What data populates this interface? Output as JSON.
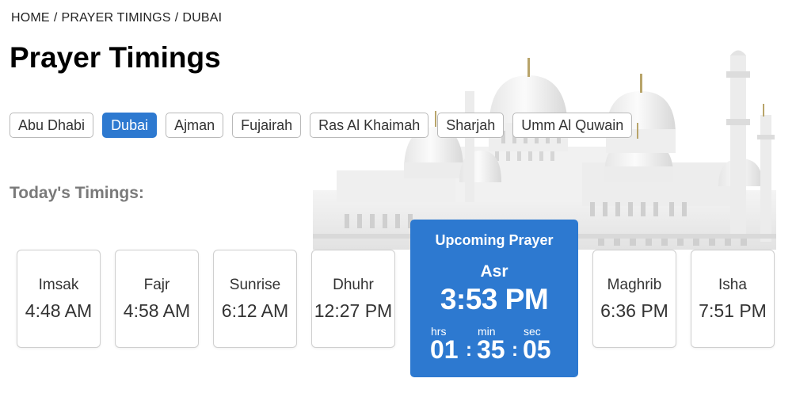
{
  "breadcrumb": {
    "home": "HOME",
    "section": "PRAYER TIMINGS",
    "current": "DUBAI",
    "separator": "/"
  },
  "page": {
    "title": "Prayer Timings",
    "section_title": "Today's Timings:"
  },
  "emirates": [
    {
      "label": "Abu Dhabi",
      "active": false
    },
    {
      "label": "Dubai",
      "active": true
    },
    {
      "label": "Ajman",
      "active": false
    },
    {
      "label": "Fujairah",
      "active": false
    },
    {
      "label": "Ras Al Khaimah",
      "active": false
    },
    {
      "label": "Sharjah",
      "active": false
    },
    {
      "label": "Umm Al Quwain",
      "active": false
    }
  ],
  "timings": [
    {
      "name": "Imsak",
      "time": "4:48 AM"
    },
    {
      "name": "Fajr",
      "time": "4:58 AM"
    },
    {
      "name": "Sunrise",
      "time": "6:12 AM"
    },
    {
      "name": "Dhuhr",
      "time": "12:27 PM"
    },
    {
      "name": "Maghrib",
      "time": "6:36 PM"
    },
    {
      "name": "Isha",
      "time": "7:51 PM"
    }
  ],
  "upcoming": {
    "label": "Upcoming Prayer",
    "name": "Asr",
    "time": "3:53 PM",
    "countdown": {
      "hrs_label": "hrs",
      "min_label": "min",
      "sec_label": "sec",
      "hrs": "01",
      "min": "35",
      "sec": "05",
      "separator": ":"
    }
  },
  "colors": {
    "accent": "#2d79d0",
    "muted_heading": "#7a7a7a",
    "border": "#cfcfcf"
  },
  "background_image": "mosque-illustration"
}
